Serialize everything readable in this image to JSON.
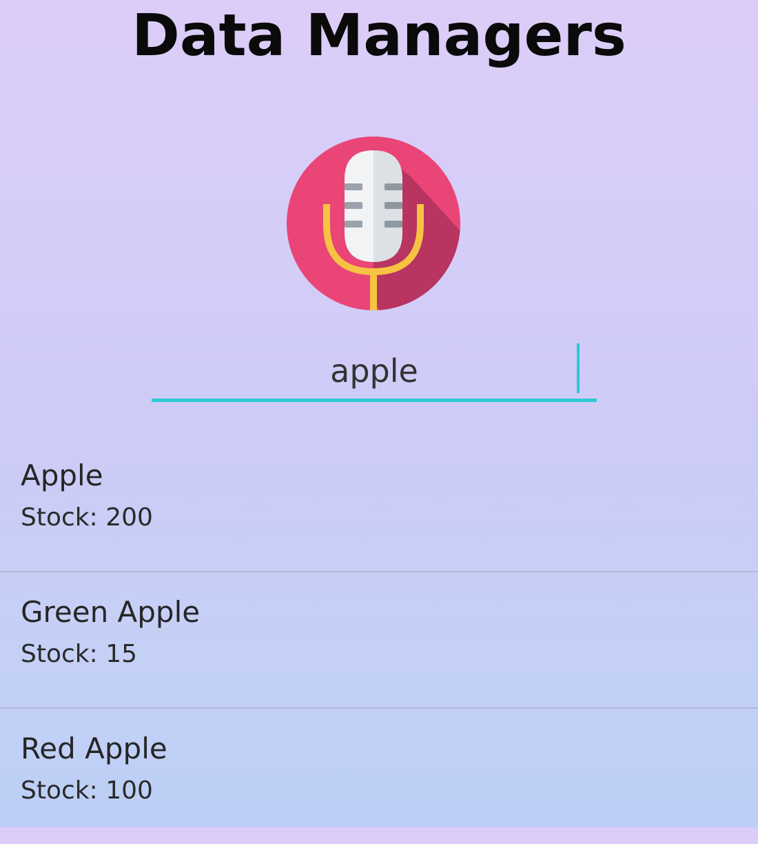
{
  "app": {
    "title": "Data Managers"
  },
  "voice": {
    "icon": "microphone-icon",
    "colors": {
      "circle": "#ea4577",
      "shadow": "#b3325e",
      "mic_left": "#f2f3f5",
      "mic_right": "#dde0e4",
      "grille": "#9aa3ab",
      "stand": "#f6c343"
    }
  },
  "search": {
    "value": "apple",
    "accent_color": "#2cc9d4"
  },
  "results": [
    {
      "name": "Apple",
      "stock_text": "Stock: 200"
    },
    {
      "name": "Green Apple",
      "stock_text": "Stock: 15"
    },
    {
      "name": "Red Apple",
      "stock_text": "Stock: 100"
    }
  ]
}
